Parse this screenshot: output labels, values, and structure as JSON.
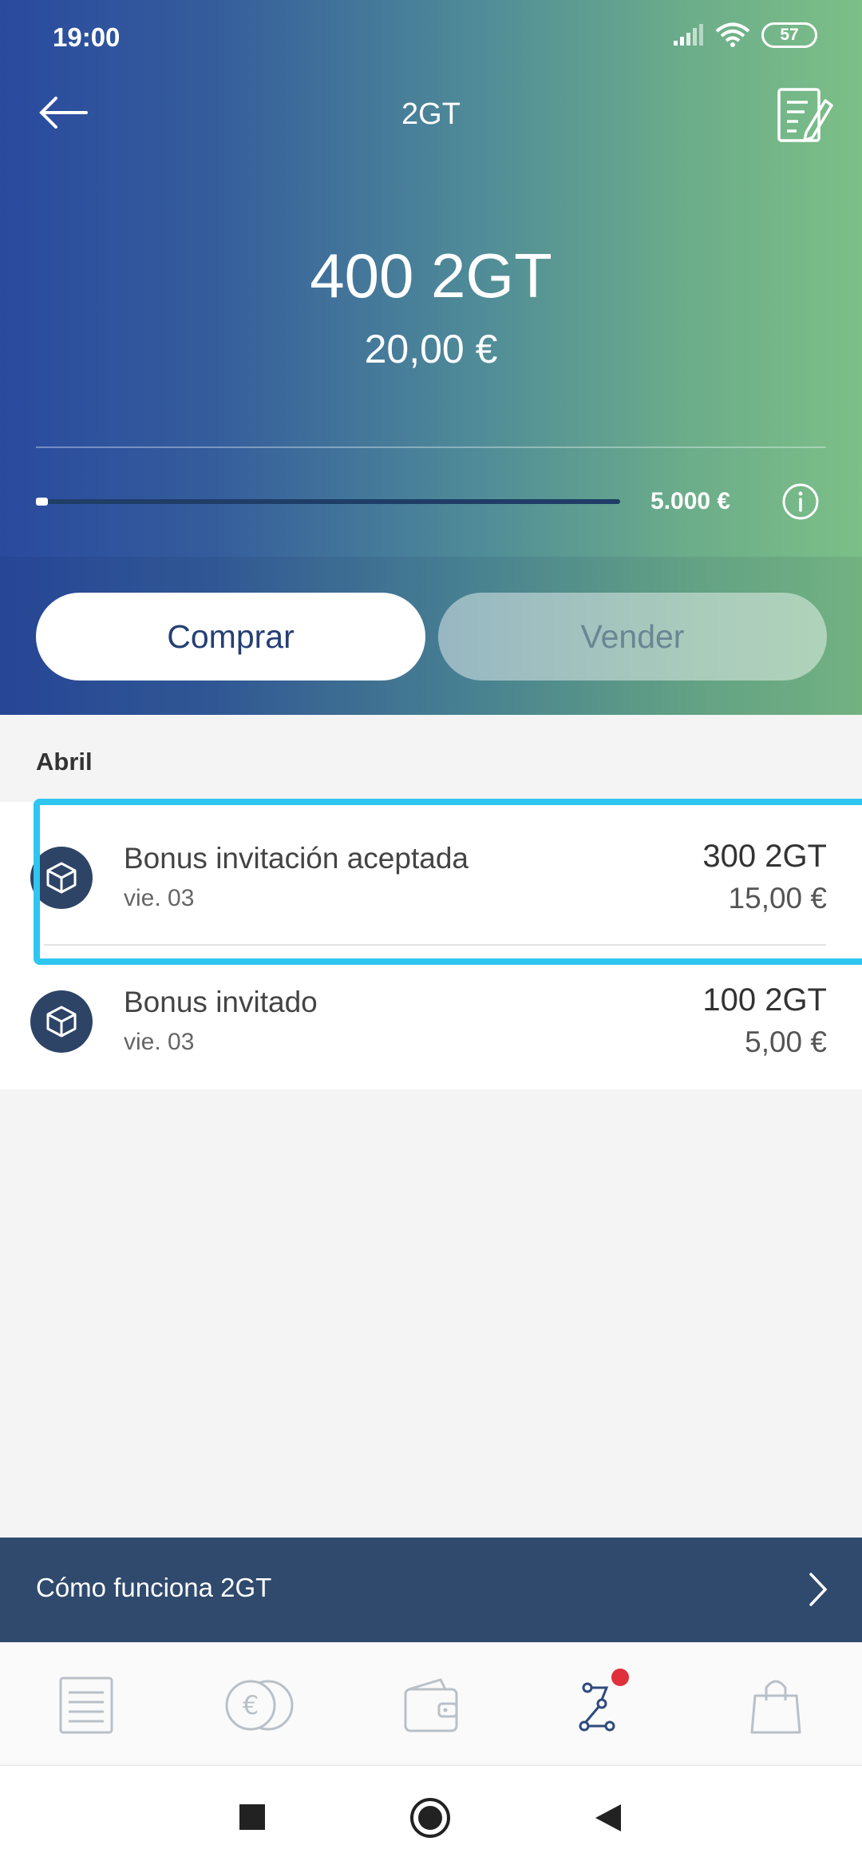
{
  "status_bar": {
    "time": "19:00",
    "battery": "57"
  },
  "header": {
    "title": "2GT"
  },
  "balance": {
    "amount": "400 2GT",
    "fiat": "20,00 €"
  },
  "limit": {
    "progress": 0.02,
    "label": "5.000 €"
  },
  "actions": {
    "buy_label": "Comprar",
    "sell_label": "Vender"
  },
  "section": {
    "month": "Abril"
  },
  "transactions": [
    {
      "title": "Bonus invitación aceptada",
      "date": "vie. 03",
      "amount": "300 2GT",
      "fiat": "15,00 €"
    },
    {
      "title": "Bonus invitado",
      "date": "vie. 03",
      "amount": "100 2GT",
      "fiat": "5,00 €"
    }
  ],
  "howto": {
    "label": "Cómo funciona 2GT"
  },
  "tabs": [
    {
      "icon": "list-icon"
    },
    {
      "icon": "euro-coins-icon"
    },
    {
      "icon": "wallet-icon"
    },
    {
      "icon": "route-icon",
      "badge": true,
      "active": true
    },
    {
      "icon": "shopping-bag-icon"
    }
  ],
  "colors": {
    "accent": "#253f74",
    "highlight": "#2ec6f0",
    "badge": "#e0303a",
    "howto_bg": "#2f4a6d"
  }
}
